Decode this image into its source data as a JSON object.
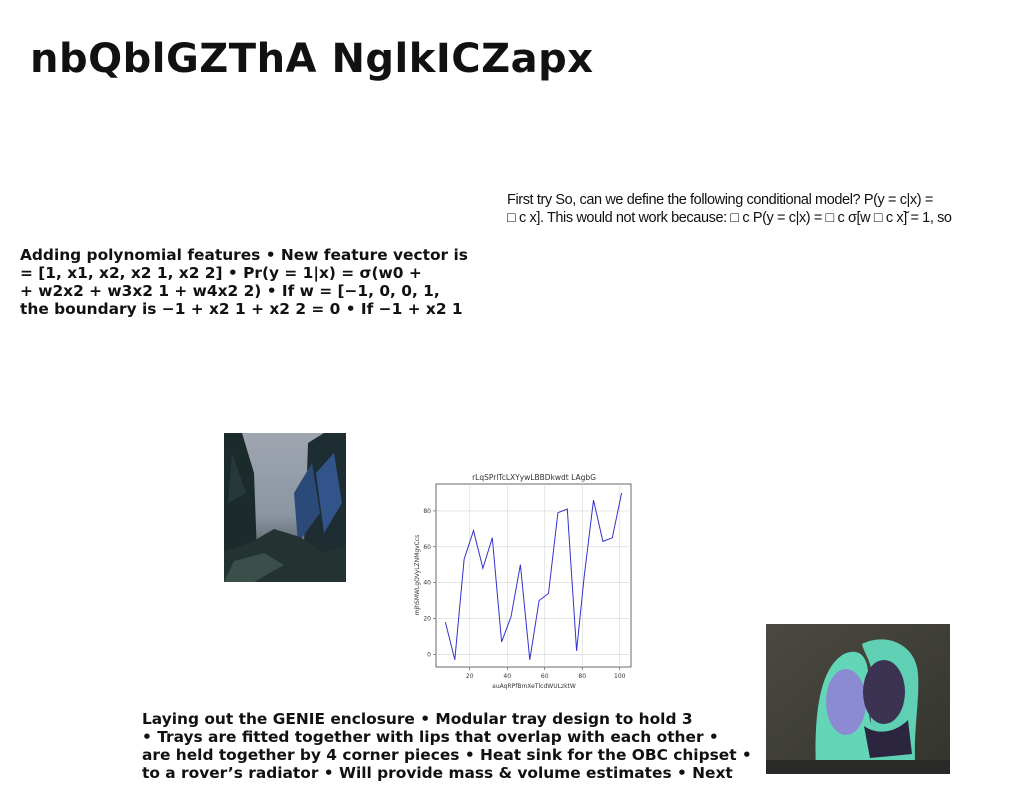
{
  "title": "nbQblGZThA NglkICZapx",
  "slide_text": {
    "lines": [
      "First try So, can we define the following conditional model? P(y = c|x) =",
      "□ c x]. This would not work because: □ c P(y = c|x) = □ c σ[w □ c x]̆ = 1, so"
    ]
  },
  "polynomial_text": {
    "lines": [
      "Adding polynomial features • New feature vector is",
      "= [1, x1, x2, x2 1, x2 2] • Pr(y = 1|x) = σ(w0 +",
      "+ w2x2 + w3x2 1 + w4x2 2) • If w = [−1, 0, 0, 1,",
      "the boundary is −1 + x2 1 + x2 2 = 0 • If −1 + x2 1"
    ]
  },
  "genie_text": {
    "lines": [
      "Laying out the GENIE enclosure • Modular tray design to hold 3",
      "• Trays are fitted together with lips that overlap with each other •",
      "are held together by 4 corner pieces • Heat sink for the OBC chipset •",
      "to a rover’s radiator • Will provide mass & volume estimates • Next"
    ]
  },
  "chart_data": {
    "type": "line",
    "title": "rLqSPrlTcLXYywLBBDkwdt LAgbG",
    "xlabel": "auAqRPfBmXeTlcdWULzktW",
    "ylabel": "mjhSMWLgOVyLZNMgvCcs",
    "x": [
      7,
      12,
      17,
      22,
      27,
      32,
      37,
      42,
      47,
      52,
      57,
      62,
      67,
      72,
      77,
      81,
      86,
      91,
      96,
      101
    ],
    "y": [
      18,
      -3,
      53,
      69,
      48,
      65,
      7,
      21,
      50,
      -3,
      30,
      34,
      79,
      81,
      2,
      43,
      86,
      63,
      65,
      90
    ],
    "xticks": [
      20,
      40,
      60,
      80,
      100
    ],
    "yticks": [
      0,
      20,
      40,
      60,
      80
    ],
    "xlim": [
      2,
      106
    ],
    "ylim": [
      -7,
      95
    ],
    "grid": true,
    "line_color": "#3333cc"
  }
}
